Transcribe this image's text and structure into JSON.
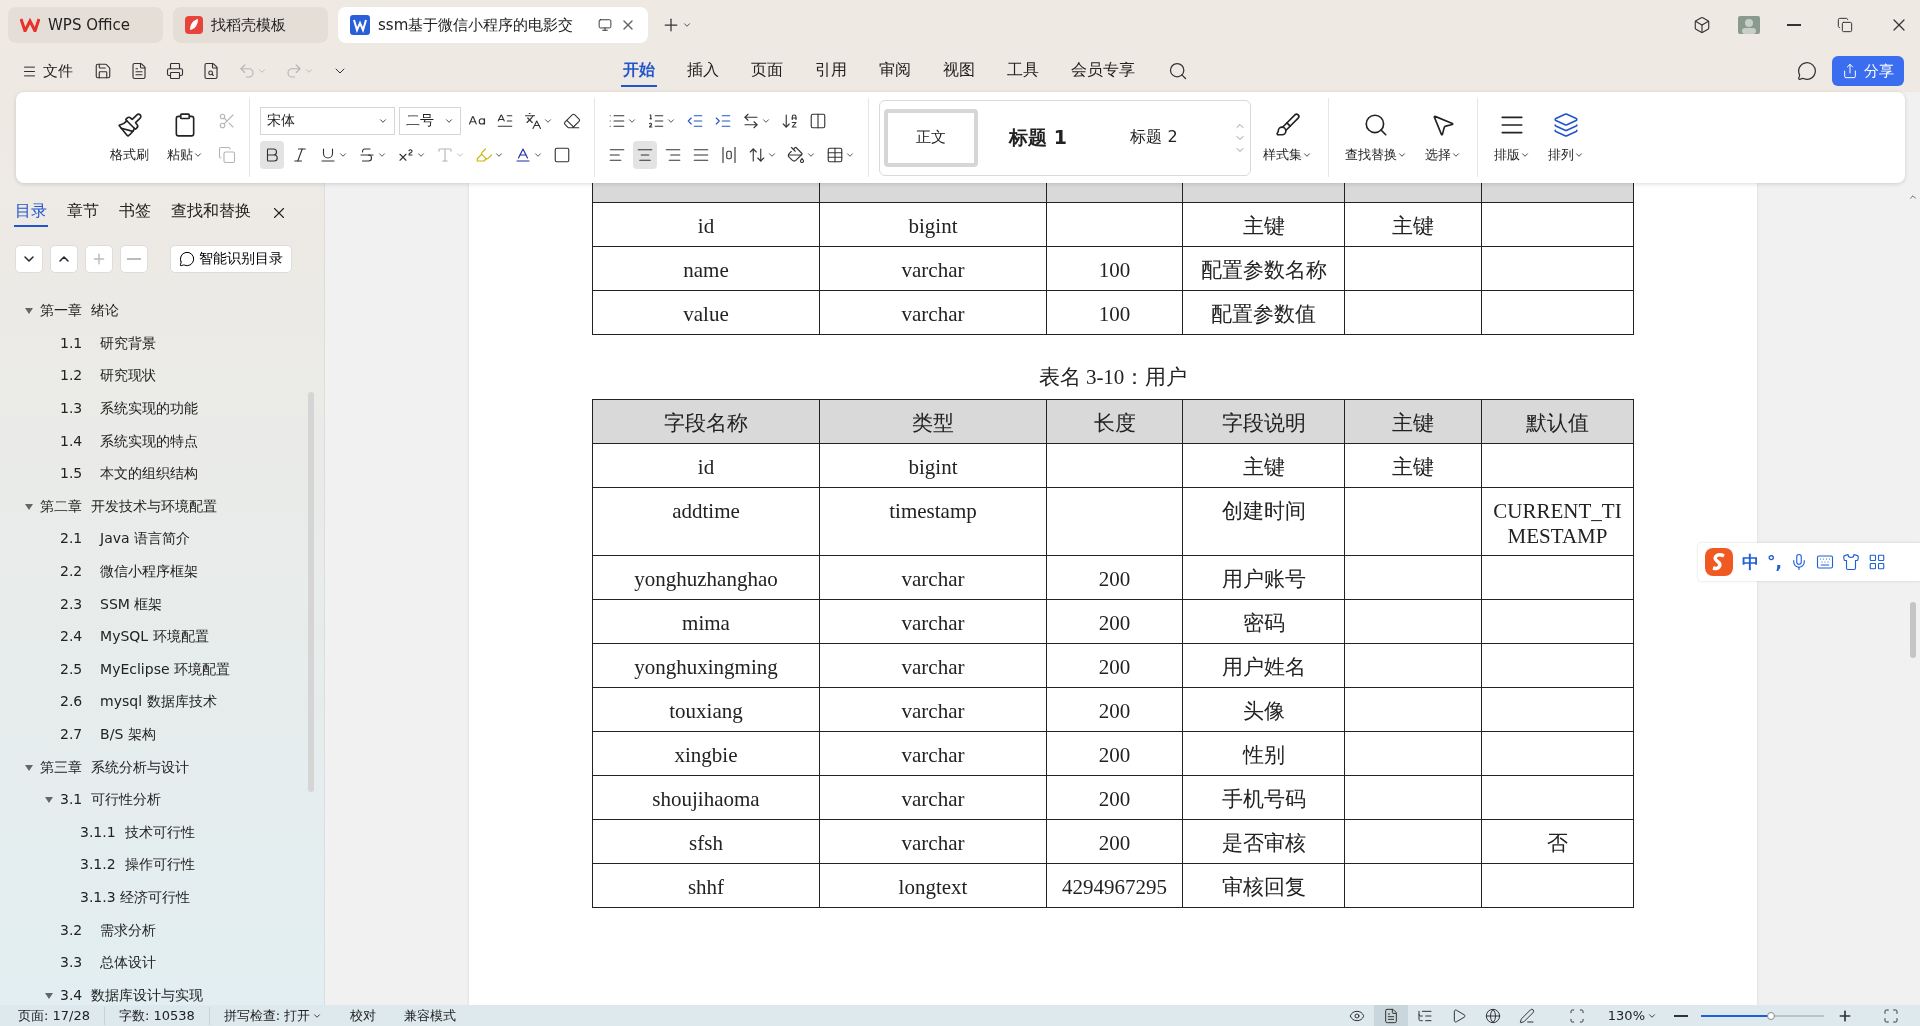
{
  "title_bar": {
    "tabs": [
      {
        "label": "WPS Office",
        "selected": false,
        "kind": "home"
      },
      {
        "label": "找稻壳模板",
        "selected": false,
        "kind": "template"
      },
      {
        "label": "ssm基于微信小程序的电影交",
        "selected": true,
        "kind": "document"
      }
    ]
  },
  "menu": {
    "file": "文件",
    "tabs": [
      {
        "label": "开始",
        "selected": true
      },
      {
        "label": "插入",
        "selected": false
      },
      {
        "label": "页面",
        "selected": false
      },
      {
        "label": "引用",
        "selected": false
      },
      {
        "label": "审阅",
        "selected": false
      },
      {
        "label": "视图",
        "selected": false
      },
      {
        "label": "工具",
        "selected": false
      },
      {
        "label": "会员专享",
        "selected": false
      }
    ],
    "share": "分享"
  },
  "ribbon": {
    "format_painter": "格式刷",
    "paste": "粘贴",
    "clipboard_tools": [
      {
        "disabled": true
      },
      {
        "disabled": true
      }
    ],
    "font": "宋体",
    "size": "二号",
    "text_format": [
      {
        "selected": true,
        "disabled": false
      },
      {
        "selected": false,
        "disabled": false
      },
      {
        "selected": false,
        "disabled": false
      },
      {
        "selected": false,
        "disabled": false
      },
      {
        "selected": false,
        "disabled": false
      },
      {
        "selected": false,
        "disabled": true
      }
    ],
    "alignment": [
      {
        "selected": false
      },
      {
        "selected": true
      },
      {
        "selected": false
      },
      {
        "selected": false
      },
      {
        "selected": false
      }
    ],
    "styles": [
      {
        "label": "正文",
        "selected": true
      },
      {
        "label": "标题 1",
        "selected": false
      },
      {
        "label": "标题 2",
        "selected": false
      }
    ],
    "style_set": "样式集",
    "find_replace": "查找替换",
    "select": "选择",
    "layout": "排版",
    "arrange": "排列"
  },
  "sidebar": {
    "tabs": [
      {
        "label": "目录",
        "selected": true
      },
      {
        "label": "章节",
        "selected": false
      },
      {
        "label": "书签",
        "selected": false
      },
      {
        "label": "查找和替换",
        "selected": false
      }
    ],
    "nav_buttons": [
      {
        "disabled": false
      },
      {
        "disabled": false
      },
      {
        "disabled": true
      },
      {
        "disabled": true
      }
    ],
    "smart_toc": "智能识别目录",
    "toc": [
      {
        "label": "第一章  绪论",
        "expanded": true,
        "children": [
          {
            "label": "1.1    研究背景"
          },
          {
            "label": "1.2    研究现状"
          },
          {
            "label": "1.3    系统实现的功能"
          },
          {
            "label": "1.4    系统实现的特点"
          },
          {
            "label": "1.5    本文的组织结构"
          }
        ]
      },
      {
        "label": "第二章  开发技术与环境配置",
        "expanded": true,
        "children": [
          {
            "label": "2.1    Java 语言简介"
          },
          {
            "label": "2.2    微信小程序框架"
          },
          {
            "label": "2.3    SSM 框架"
          },
          {
            "label": "2.4    MySQL 环境配置"
          },
          {
            "label": "2.5    MyEclipse 环境配置"
          },
          {
            "label": "2.6    mysql 数据库技术"
          },
          {
            "label": "2.7    B/S 架构"
          }
        ]
      },
      {
        "label": "第三章  系统分析与设计",
        "expanded": true,
        "children": [
          {
            "label": "3.1  可行性分析",
            "expanded": true,
            "children": [
              {
                "label": "3.1.1  技术可行性"
              },
              {
                "label": "3.1.2  操作可行性"
              },
              {
                "label": "3.1.3 经济可行性"
              }
            ]
          },
          {
            "label": "3.2    需求分析"
          },
          {
            "label": "3.3    总体设计"
          },
          {
            "label": "3.4  数据库设计与实现",
            "expanded": true
          }
        ]
      }
    ]
  },
  "document": {
    "tables": [
      {
        "rows": [
          [
            "id",
            "bigint",
            null,
            "主键",
            "主键",
            null
          ],
          [
            "name",
            "varchar",
            "100",
            "配置参数名称",
            null,
            null
          ],
          [
            "value",
            "varchar",
            "100",
            "配置参数值",
            null,
            null
          ]
        ]
      },
      {
        "caption": "表名 3-10：用户",
        "columns": [
          "字段名称",
          "类型",
          "长度",
          "字段说明",
          "主键",
          "默认值"
        ],
        "rows": [
          [
            "id",
            "bigint",
            null,
            "主键",
            "主键",
            null
          ],
          [
            "addtime",
            "timestamp",
            null,
            "创建时间",
            null,
            "CURRENT_TIMESTAMP"
          ],
          [
            "yonghuzhanghao",
            "varchar",
            "200",
            "用户账号",
            null,
            null
          ],
          [
            "mima",
            "varchar",
            "200",
            "密码",
            null,
            null
          ],
          [
            "yonghuxingming",
            "varchar",
            "200",
            "用户姓名",
            null,
            null
          ],
          [
            "touxiang",
            "varchar",
            "200",
            "头像",
            null,
            null
          ],
          [
            "xingbie",
            "varchar",
            "200",
            "性别",
            null,
            null
          ],
          [
            "shoujihaoma",
            "varchar",
            "200",
            "手机号码",
            null,
            null
          ],
          [
            "sfsh",
            "varchar",
            "200",
            "是否审核",
            null,
            "否"
          ],
          [
            "shhf",
            "longtext",
            "4294967295",
            "审核回复",
            null,
            null
          ]
        ]
      }
    ]
  },
  "ime": {
    "mode": "中",
    "punctuation": "°,"
  },
  "status_bar": {
    "page": "页面: 17/28",
    "words": "字数: 10538",
    "spell": "拼写检查: 打开",
    "proofread": "校对",
    "compat": "兼容模式",
    "view_modes": [
      {
        "selected": false
      },
      {
        "selected": true
      },
      {
        "selected": false
      },
      {
        "selected": false
      },
      {
        "selected": false
      },
      {
        "selected": false
      }
    ],
    "zoom": "130%",
    "zoom_slider": {
      "level": 0.57
    }
  }
}
